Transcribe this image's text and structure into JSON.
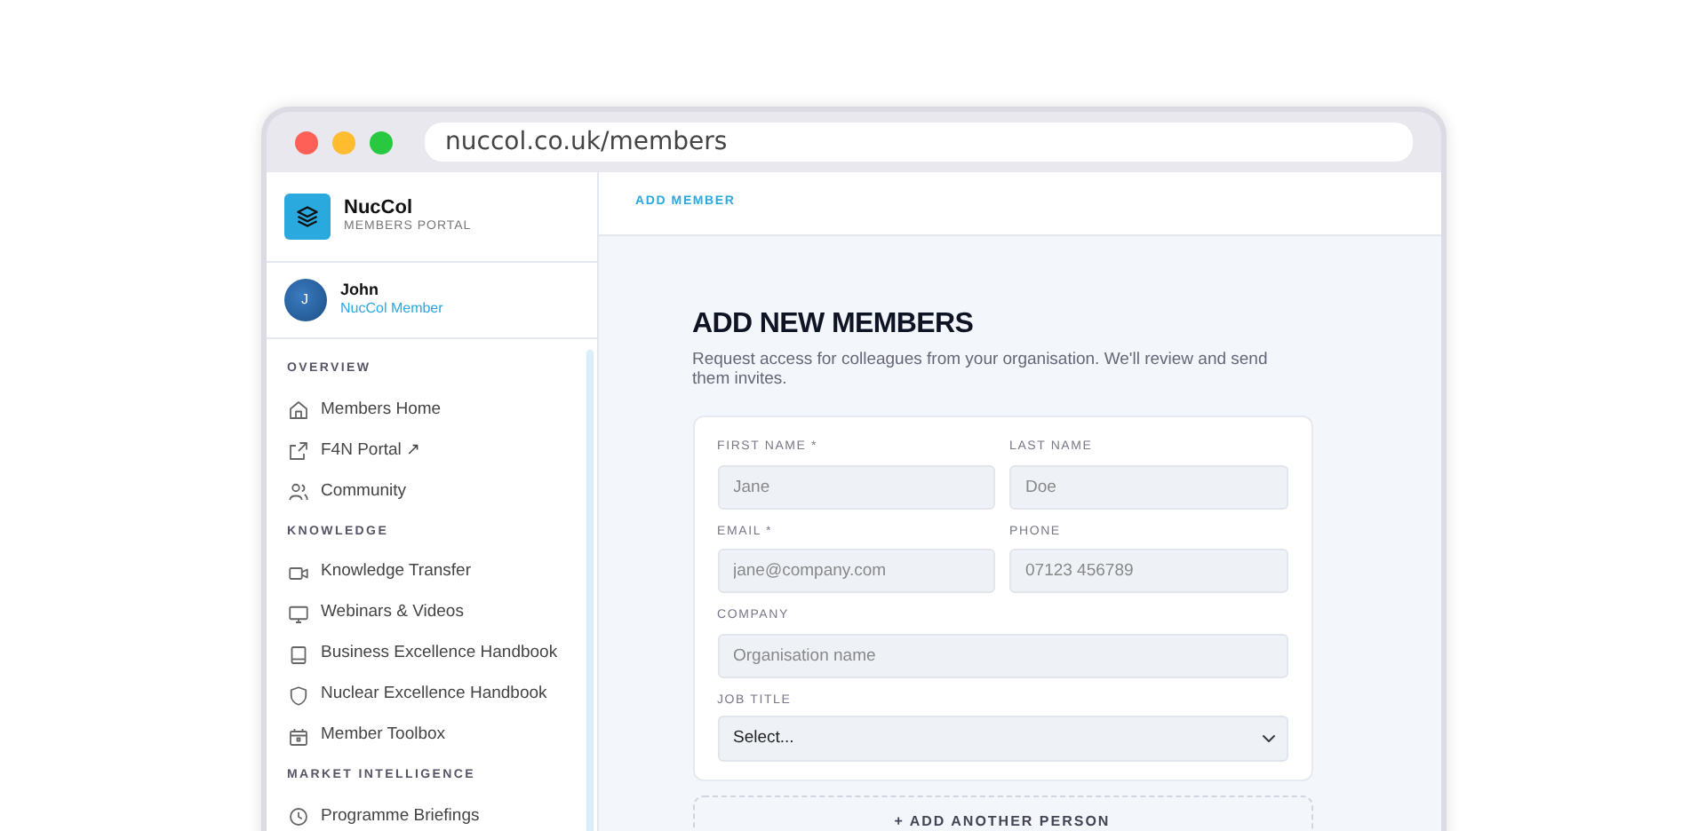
{
  "browser": {
    "url": "nuccol.co.uk/members"
  },
  "brand": {
    "name": "NucCol",
    "tagline": "MEMBERS PORTAL"
  },
  "user": {
    "initial": "J",
    "name": "John",
    "role": "NucCol Member"
  },
  "sidebar": [
    {
      "title": "OVERVIEW",
      "items": [
        {
          "label": "Members Home"
        },
        {
          "label": "F4N Portal ↗"
        },
        {
          "label": "Community"
        }
      ]
    },
    {
      "title": "KNOWLEDGE",
      "items": [
        {
          "label": "Knowledge Transfer"
        },
        {
          "label": "Webinars & Videos"
        },
        {
          "label": "Business Excellence Handbook"
        },
        {
          "label": "Nuclear Excellence Handbook"
        },
        {
          "label": "Member Toolbox"
        }
      ]
    },
    {
      "title": "MARKET INTELLIGENCE",
      "items": [
        {
          "label": "Programme Briefings"
        }
      ]
    }
  ],
  "breadcrumb": "ADD MEMBER",
  "page": {
    "title": "ADD NEW MEMBERS",
    "intro": "Request access for colleagues from your organisation. We'll review and send them invites."
  },
  "form": {
    "fields": [
      {
        "kind": "text",
        "label": "FIRST NAME *",
        "placeholder": "Jane",
        "half": true
      },
      {
        "kind": "text",
        "label": "LAST NAME",
        "placeholder": "Doe",
        "half": true
      },
      {
        "kind": "text",
        "label": "EMAIL *",
        "placeholder": "jane@company.com",
        "half": true
      },
      {
        "kind": "text",
        "label": "PHONE",
        "placeholder": "07123 456789",
        "half": true
      },
      {
        "kind": "text",
        "label": "COMPANY",
        "placeholder": "Organisation name",
        "half": false
      },
      {
        "kind": "select",
        "label": "JOB TITLE",
        "value": "Select...",
        "half": false
      }
    ]
  },
  "add_button": "+ ADD ANOTHER PERSON"
}
